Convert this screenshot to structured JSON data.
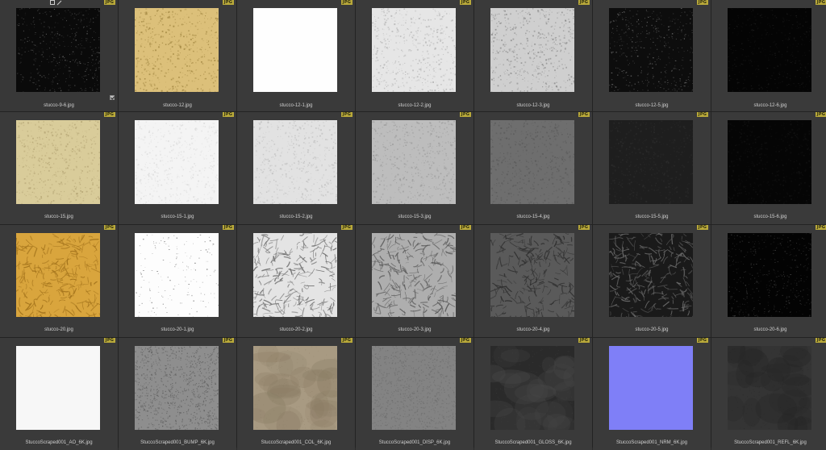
{
  "grid": {
    "badge_label": "JPG",
    "items": [
      {
        "filename": "stucco-9-6.jpg",
        "texture": "dark-speckle",
        "base": "#0a0a0a",
        "grain": "#5a5a5a",
        "selected": true
      },
      {
        "filename": "stucco-12.jpg",
        "texture": "fine-grain",
        "base": "#dcc07a",
        "grain": "#a58a45"
      },
      {
        "filename": "stucco-12-1.jpg",
        "texture": "flat",
        "base": "#fefefe",
        "grain": "#f2f2f2"
      },
      {
        "filename": "stucco-12-2.jpg",
        "texture": "fine-grain",
        "base": "#e6e6e6",
        "grain": "#b8b8b8"
      },
      {
        "filename": "stucco-12-3.jpg",
        "texture": "fine-grain",
        "base": "#cfcfcf",
        "grain": "#8e8e8e"
      },
      {
        "filename": "stucco-12-5.jpg",
        "texture": "dark-speckle",
        "base": "#0d0d0d",
        "grain": "#6a6a6a"
      },
      {
        "filename": "stucco-12-6.jpg",
        "texture": "dark-speckle",
        "base": "#040404",
        "grain": "#1c1c1c"
      },
      {
        "filename": "stucco-15.jpg",
        "texture": "fine-grain",
        "base": "#d9cc9a",
        "grain": "#b8a878"
      },
      {
        "filename": "stucco-15-1.jpg",
        "texture": "fine-grain",
        "base": "#f4f4f4",
        "grain": "#dddddd"
      },
      {
        "filename": "stucco-15-2.jpg",
        "texture": "fine-grain",
        "base": "#e2e2e2",
        "grain": "#c2c2c2"
      },
      {
        "filename": "stucco-15-3.jpg",
        "texture": "fine-grain",
        "base": "#bdbdbd",
        "grain": "#9c9c9c"
      },
      {
        "filename": "stucco-15-4.jpg",
        "texture": "fine-grain",
        "base": "#6e6e6e",
        "grain": "#5a5a5a"
      },
      {
        "filename": "stucco-15-5.jpg",
        "texture": "fine-grain",
        "base": "#1e1e1e",
        "grain": "#2c2c2c"
      },
      {
        "filename": "stucco-15-6.jpg",
        "texture": "fine-grain",
        "base": "#050505",
        "grain": "#121212"
      },
      {
        "filename": "stucco-20.jpg",
        "texture": "scraped",
        "base": "#d9a53d",
        "grain": "#a3731c"
      },
      {
        "filename": "stucco-20-1.jpg",
        "texture": "sparse-dots",
        "base": "#fdfdfd",
        "grain": "#7a7a7a"
      },
      {
        "filename": "stucco-20-2.jpg",
        "texture": "scraped",
        "base": "#e4e4e4",
        "grain": "#6f6f6f"
      },
      {
        "filename": "stucco-20-3.jpg",
        "texture": "scraped",
        "base": "#aeaeae",
        "grain": "#5a5a5a"
      },
      {
        "filename": "stucco-20-4.jpg",
        "texture": "scraped",
        "base": "#5a5a5a",
        "grain": "#2e2e2e"
      },
      {
        "filename": "stucco-20-5.jpg",
        "texture": "scraped",
        "base": "#1a1a1a",
        "grain": "#6a6a6a"
      },
      {
        "filename": "stucco-20-6.jpg",
        "texture": "dark-speckle",
        "base": "#030303",
        "grain": "#3a3a3a"
      },
      {
        "filename": "StuccoScraped001_AO_6K.jpg",
        "texture": "flat",
        "base": "#f7f7f7",
        "grain": "#ececec"
      },
      {
        "filename": "StuccoScraped001_BUMP_6K.jpg",
        "texture": "noise",
        "base": "#8e8e8e",
        "grain": "#5e5e5e"
      },
      {
        "filename": "StuccoScraped001_COL_6K.jpg",
        "texture": "cloudy",
        "base": "#a89a82",
        "grain": "#8a7c64"
      },
      {
        "filename": "StuccoScraped001_DISP_6K.jpg",
        "texture": "noise",
        "base": "#838383",
        "grain": "#6d6d6d"
      },
      {
        "filename": "StuccoScraped001_GLOSS_6K.jpg",
        "texture": "cloudy",
        "base": "#2a2a2a",
        "grain": "#474747"
      },
      {
        "filename": "StuccoScraped001_NRM_6K.jpg",
        "texture": "flat",
        "base": "#7f7ff7",
        "grain": "#8585fa"
      },
      {
        "filename": "StuccoScraped001_REFL_6K.jpg",
        "texture": "cloudy",
        "base": "#343434",
        "grain": "#262626"
      }
    ]
  }
}
